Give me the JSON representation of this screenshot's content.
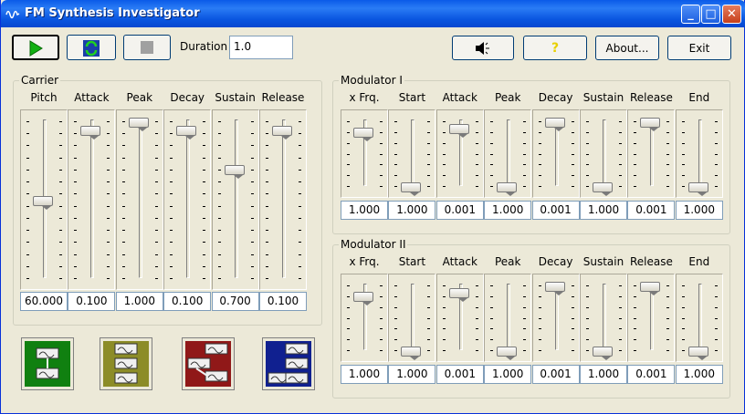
{
  "title": "FM Synthesis Investigator",
  "window_buttons": {
    "minimize": "_",
    "maximize": "□",
    "close": "✕"
  },
  "toolbar": {
    "duration_label": "Duration",
    "duration_value": "1.0",
    "about": "About...",
    "exit": "Exit",
    "help": "?"
  },
  "carrier": {
    "title": "Carrier",
    "channels": [
      {
        "label": "Pitch",
        "value": "60.000",
        "level": 0.5
      },
      {
        "label": "Attack",
        "value": "0.100",
        "level": 0.95
      },
      {
        "label": "Peak",
        "value": "1.000",
        "level": 1.0
      },
      {
        "label": "Decay",
        "value": "0.100",
        "level": 0.95
      },
      {
        "label": "Sustain",
        "value": "0.700",
        "level": 0.7
      },
      {
        "label": "Release",
        "value": "0.100",
        "level": 0.95
      }
    ]
  },
  "mod1": {
    "title": "Modulator I",
    "channels": [
      {
        "label": "x Frq.",
        "value": "1.000",
        "level": 0.85
      },
      {
        "label": "Start",
        "value": "1.000",
        "level": 0.0
      },
      {
        "label": "Attack",
        "value": "0.001",
        "level": 0.9
      },
      {
        "label": "Peak",
        "value": "1.000",
        "level": 0.0
      },
      {
        "label": "Decay",
        "value": "0.001",
        "level": 1.0
      },
      {
        "label": "Sustain",
        "value": "1.000",
        "level": 0.0
      },
      {
        "label": "Release",
        "value": "0.001",
        "level": 1.0
      },
      {
        "label": "End",
        "value": "1.000",
        "level": 0.0
      }
    ]
  },
  "mod2": {
    "title": "Modulator II",
    "channels": [
      {
        "label": "x Frq.",
        "value": "1.000",
        "level": 0.85
      },
      {
        "label": "Start",
        "value": "1.000",
        "level": 0.0
      },
      {
        "label": "Attack",
        "value": "0.001",
        "level": 0.9
      },
      {
        "label": "Peak",
        "value": "1.000",
        "level": 0.0
      },
      {
        "label": "Decay",
        "value": "0.001",
        "level": 1.0
      },
      {
        "label": "Sustain",
        "value": "1.000",
        "level": 0.0
      },
      {
        "label": "Release",
        "value": "0.001",
        "level": 1.0
      },
      {
        "label": "End",
        "value": "1.000",
        "level": 0.0
      }
    ]
  },
  "algorithms": [
    {
      "name": "algorithm-1",
      "color": "#108010"
    },
    {
      "name": "algorithm-2",
      "color": "#8c8c28"
    },
    {
      "name": "algorithm-3",
      "color": "#901818"
    },
    {
      "name": "algorithm-4",
      "color": "#102090"
    }
  ]
}
